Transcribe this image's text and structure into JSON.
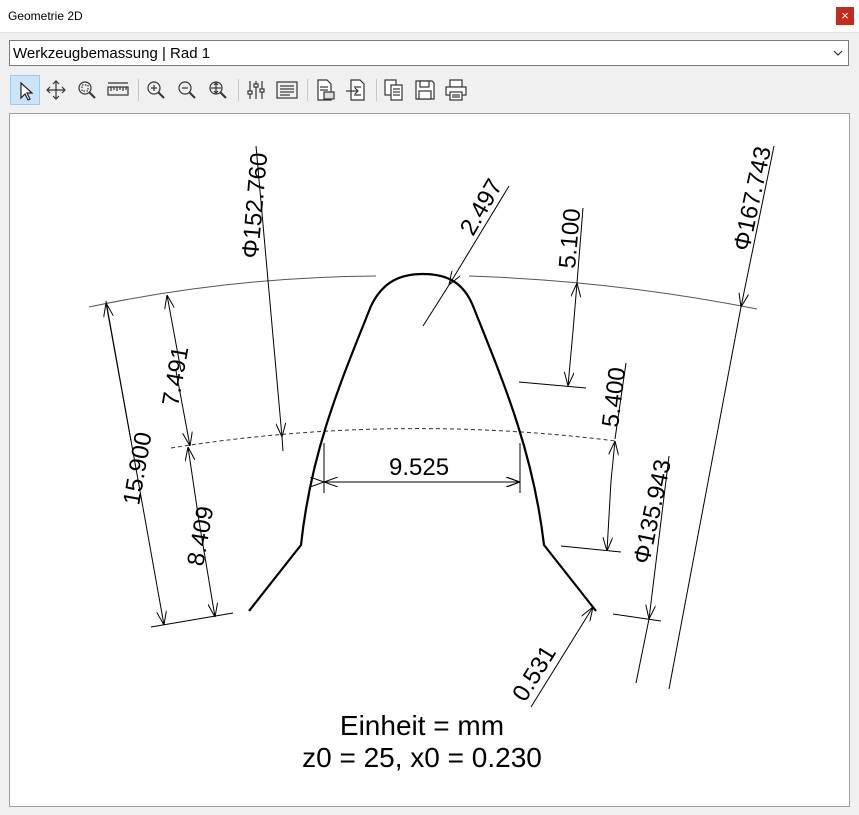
{
  "window": {
    "title": "Geometrie 2D",
    "close_glyph": "×"
  },
  "selector": {
    "selected": "Werkzeugbemassung | Rad 1"
  },
  "toolbar": {
    "tools": [
      {
        "name": "select-tool",
        "icon": "pointer-icon",
        "active": true
      },
      {
        "name": "pan-tool",
        "icon": "move-icon"
      },
      {
        "name": "zoom-window-tool",
        "icon": "zoom-window-icon"
      },
      {
        "name": "measure-tool",
        "icon": "ruler-icon"
      },
      {
        "name": "zoom-in-tool",
        "icon": "zoom-in-icon"
      },
      {
        "name": "zoom-out-tool",
        "icon": "zoom-out-icon"
      },
      {
        "name": "zoom-fit-tool",
        "icon": "zoom-fit-icon"
      },
      {
        "name": "settings-tool",
        "icon": "sliders-icon"
      },
      {
        "name": "text-tool",
        "icon": "text-lines-icon"
      },
      {
        "name": "export-tool",
        "icon": "document-export-icon"
      },
      {
        "name": "import-tool",
        "icon": "document-import-icon"
      },
      {
        "name": "copy-tool",
        "icon": "copy-icon"
      },
      {
        "name": "save-tool",
        "icon": "save-icon"
      },
      {
        "name": "print-tool",
        "icon": "printer-icon"
      }
    ]
  },
  "drawing": {
    "dimensions": {
      "d_root": "Φ152.760",
      "tip_radius": "2.497",
      "dim_5100": "5.100",
      "d_tip": "Φ167.743",
      "dim_7491": "7.491",
      "dim_15900": "15.900",
      "dim_8409": "8.409",
      "width_9525": "9.525",
      "dim_5400": "5.400",
      "d_inner": "Φ135.943",
      "root_radius": "0.531"
    },
    "unit_line": "Einheit = mm",
    "params_line": "z0 = 25, x0 = 0.230"
  }
}
